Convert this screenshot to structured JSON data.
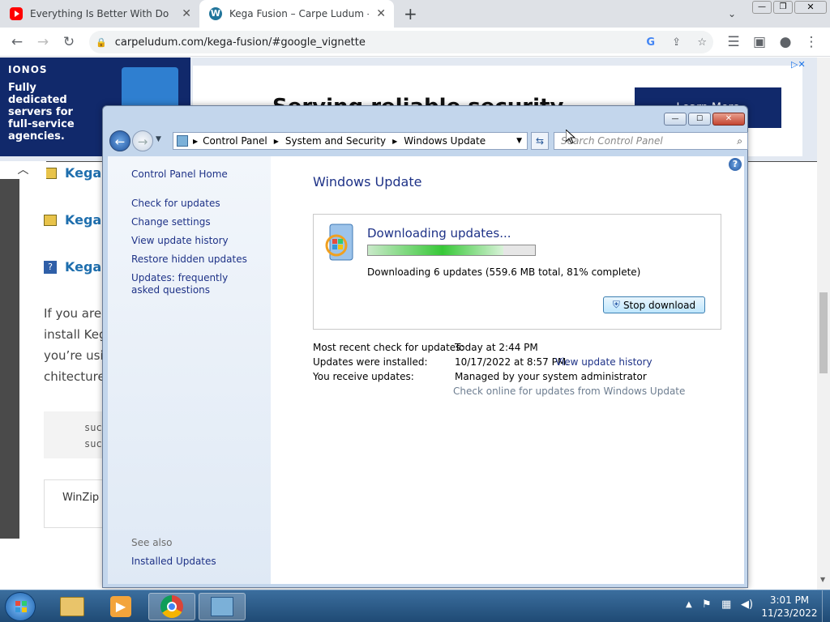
{
  "browser": {
    "tabs": [
      {
        "title": "Everything Is Better With Doodle",
        "favicon": "youtube-icon"
      },
      {
        "title": "Kega Fusion – Carpe Ludum – Ei",
        "favicon": "wordpress-icon"
      }
    ],
    "url": "carpeludum.com/kega-fusion/#google_vignette"
  },
  "ad": {
    "brand": "IONOS",
    "text": "Fully dedicated servers for full-service agencies.",
    "headline": "Serving reliable security",
    "cta": "Learn More"
  },
  "article": {
    "items": [
      "Kega",
      "Kega",
      "Kega"
    ],
    "paragraph": [
      "If you are",
      "install Keg",
      "you’re usi",
      "chitecture"
    ],
    "code": [
      "suc",
      "suc"
    ],
    "winzip": "WinZip D"
  },
  "window": {
    "breadcrumb": [
      "Control Panel",
      "System and Security",
      "Windows Update"
    ],
    "search_placeholder": "Search Control Panel",
    "left_nav": {
      "home": "Control Panel Home",
      "links": [
        "Check for updates",
        "Change settings",
        "View update history",
        "Restore hidden updates",
        "Updates: frequently asked questions"
      ],
      "see_also_label": "See also",
      "see_also_links": [
        "Installed Updates"
      ]
    },
    "main": {
      "title": "Windows Update",
      "status_title": "Downloading updates...",
      "progress": 0.81,
      "status_detail": "Downloading 6 updates (559.6 MB total, 81% complete)",
      "stop_button": "Stop download",
      "info": [
        {
          "label": "Most recent check for updates:",
          "value": "Today at 2:44 PM"
        },
        {
          "label": "Updates were installed:",
          "value": "10/17/2022 at 8:57 PM.",
          "link": "View update history"
        },
        {
          "label": "You receive updates:",
          "value": "Managed by your system administrator"
        }
      ],
      "check_online": "Check online for updates from Windows Update"
    }
  },
  "taskbar": {
    "time": "3:01 PM",
    "date": "11/23/2022"
  }
}
